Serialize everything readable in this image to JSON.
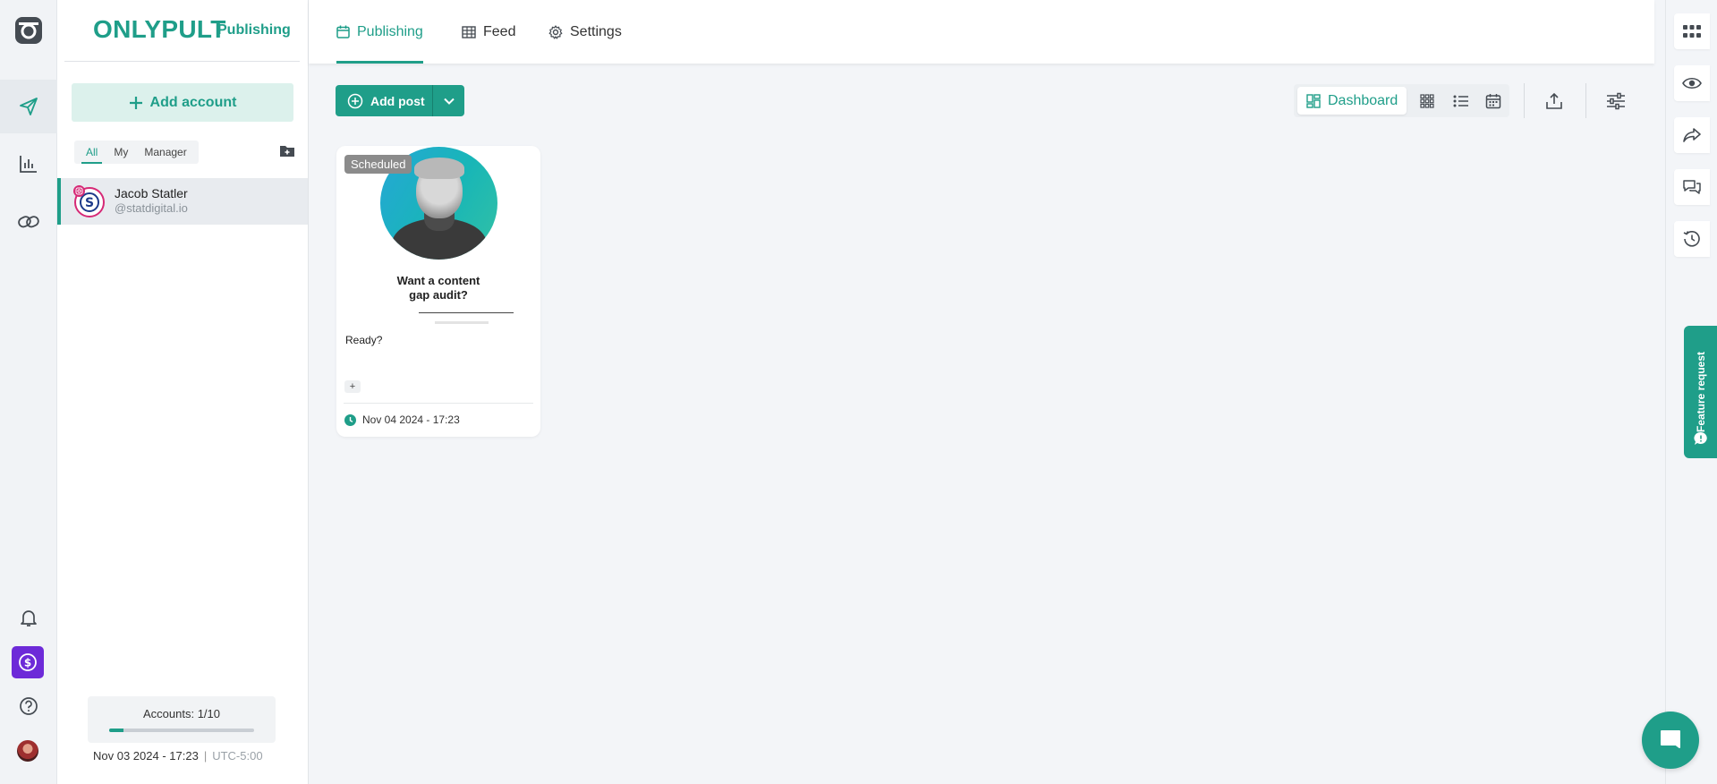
{
  "brand": {
    "logo": "ONLYPULT",
    "subtitle": "Publishing"
  },
  "sidebar": {
    "add_account_label": "Add account",
    "filters": [
      "All",
      "My",
      "Manager"
    ],
    "active_filter": "All",
    "account": {
      "name": "Jacob Statler",
      "handle": "@statdigital.io"
    },
    "quota_label": "Accounts: 1/10",
    "quota_fraction": 0.1,
    "date_time": "Nov 03 2024 - 17:23",
    "separator": "|",
    "timezone": "UTC-5:00"
  },
  "header": {
    "tabs": [
      {
        "label": "Publishing",
        "icon": "calendar-icon"
      },
      {
        "label": "Feed",
        "icon": "table-icon"
      },
      {
        "label": "Settings",
        "icon": "gear-icon"
      }
    ],
    "active_tab": "Publishing"
  },
  "toolbar": {
    "add_post_label": "Add post",
    "views": [
      "Dashboard",
      "grid-view",
      "list-view",
      "calendar-view"
    ],
    "active_view_label": "Dashboard"
  },
  "post": {
    "status": "Scheduled",
    "caption_line1": "Want a content",
    "caption_line2": "gap audit?",
    "text": "Ready?",
    "add_label": "+",
    "scheduled_at": "Nov 04 2024 - 17:23"
  },
  "feature_request_label": "Feature request",
  "colors": {
    "accent": "#1f9e89",
    "accent_light": "#dcf1ec",
    "purple": "#6d2ad8",
    "instagram": "#d62976"
  }
}
